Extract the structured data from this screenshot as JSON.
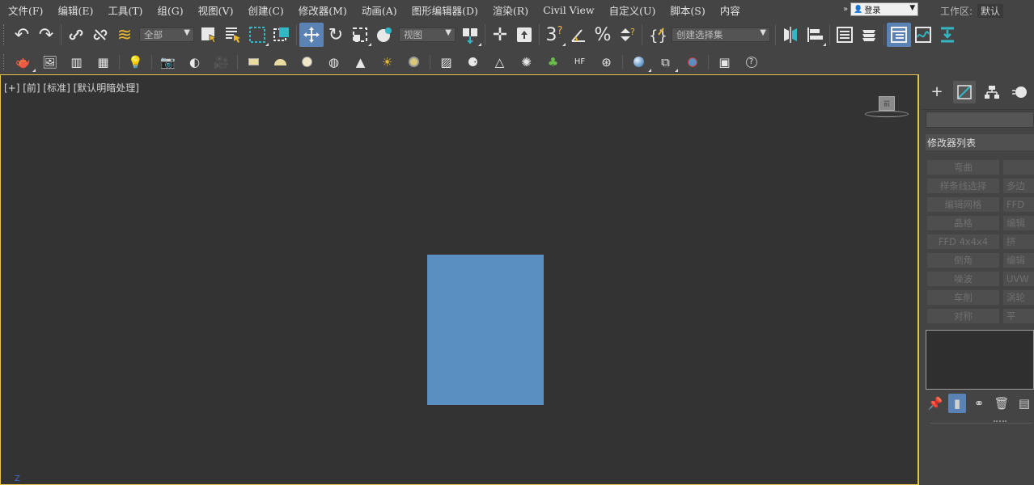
{
  "menu": {
    "items": [
      "文件(F)",
      "编辑(E)",
      "工具(T)",
      "组(G)",
      "视图(V)",
      "创建(C)",
      "修改器(M)",
      "动画(A)",
      "图形编辑器(D)",
      "渲染(R)",
      "Civil View",
      "自定义(U)",
      "脚本(S)",
      "内容"
    ],
    "login_label": "登录",
    "workspace_label": "工作区:",
    "workspace_value": "默认"
  },
  "toolbar": {
    "selection_filter": "全部",
    "ref_coord": "视图",
    "selection_set": "创建选择集",
    "snap_label": "3"
  },
  "viewport": {
    "label": "[+] [前] [标准] [默认明暗处理]",
    "box_color": "#5a8fc2",
    "axis_z": "Z"
  },
  "panel": {
    "modifier_list": "修改器列表",
    "modifier_buttons": [
      [
        "弯曲",
        ""
      ],
      [
        "样条线选择",
        "多边"
      ],
      [
        "编辑网格",
        "FFD"
      ],
      [
        "晶格",
        "编辑"
      ],
      [
        "FFD 4x4x4",
        "挤"
      ],
      [
        "倒角",
        "编辑"
      ],
      [
        "噪波",
        "UVW"
      ],
      [
        "车削",
        "涡轮"
      ],
      [
        "对称",
        "平"
      ]
    ]
  },
  "colors": {
    "viewport_border": "#e8c34a",
    "active_button": "#5b82b4"
  }
}
